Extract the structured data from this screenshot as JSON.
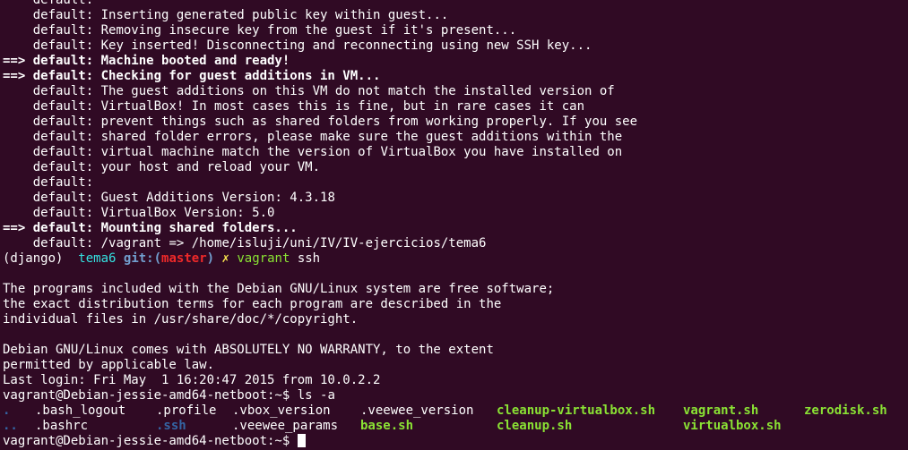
{
  "default_lines_top": [
    {
      "prefix": "    default:",
      "text": ""
    },
    {
      "prefix": "    default:",
      "text": " Inserting generated public key within guest..."
    },
    {
      "prefix": "    default:",
      "text": " Removing insecure key from the guest if it's present..."
    },
    {
      "prefix": "    default:",
      "text": " Key inserted! Disconnecting and reconnecting using new SSH key..."
    }
  ],
  "arrow_booted": "==> default: Machine booted and ready!",
  "arrow_checking": "==> default: Checking for guest additions in VM...",
  "default_lines_mid": [
    {
      "prefix": "    default:",
      "text": " The guest additions on this VM do not match the installed version of"
    },
    {
      "prefix": "    default:",
      "text": " VirtualBox! In most cases this is fine, but in rare cases it can"
    },
    {
      "prefix": "    default:",
      "text": " prevent things such as shared folders from working properly. If you see"
    },
    {
      "prefix": "    default:",
      "text": " shared folder errors, please make sure the guest additions within the"
    },
    {
      "prefix": "    default:",
      "text": " virtual machine match the version of VirtualBox you have installed on"
    },
    {
      "prefix": "    default:",
      "text": " your host and reload your VM."
    },
    {
      "prefix": "    default:",
      "text": ""
    },
    {
      "prefix": "    default:",
      "text": " Guest Additions Version: 4.3.18"
    },
    {
      "prefix": "    default:",
      "text": " VirtualBox Version: 5.0"
    }
  ],
  "arrow_mounting": "==> default: Mounting shared folders...",
  "mount_line": {
    "prefix": "    default:",
    "text": " /vagrant => /home/isluji/uni/IV/IV-ejercicios/tema6"
  },
  "prompt": {
    "venv": "(django)",
    "dir": "tema6",
    "git": "git:(",
    "branch": "master",
    "git_close": ")",
    "dirty": "✗",
    "command": "vagrant",
    "args": "ssh"
  },
  "motd": [
    "The programs included with the Debian GNU/Linux system are free software;",
    "the exact distribution terms for each program are described in the",
    "individual files in /usr/share/doc/*/copyright.",
    "",
    "Debian GNU/Linux comes with ABSOLUTELY NO WARRANTY, to the extent",
    "permitted by applicable law.",
    "Last login: Fri May  1 16:20:47 2015 from 10.0.2.2"
  ],
  "shell_prompt": "vagrant@Debian-jessie-amd64-netboot:~$",
  "ls_command": " ls -a",
  "ls_row1": [
    {
      "name": ".",
      "type": "dir"
    },
    {
      "name": ".bash_logout",
      "type": "file"
    },
    {
      "name": ".profile",
      "type": "file"
    },
    {
      "name": ".vbox_version",
      "type": "file"
    },
    {
      "name": ".veewee_version",
      "type": "file"
    },
    {
      "name": "cleanup-virtualbox.sh",
      "type": "exec"
    },
    {
      "name": "vagrant.sh",
      "type": "exec"
    },
    {
      "name": "zerodisk.sh",
      "type": "exec"
    }
  ],
  "ls_row2": [
    {
      "name": "..",
      "type": "dir"
    },
    {
      "name": ".bashrc",
      "type": "file"
    },
    {
      "name": ".ssh",
      "type": "dir"
    },
    {
      "name": ".veewee_params",
      "type": "file"
    },
    {
      "name": "base.sh",
      "type": "exec"
    },
    {
      "name": "cleanup.sh",
      "type": "exec"
    },
    {
      "name": "virtualbox.sh",
      "type": "exec"
    }
  ],
  "colors": {
    "background": "#300a24",
    "text": "#ffffff",
    "green": "#8ae234",
    "cyan": "#34e2e2",
    "red": "#ef2929",
    "yellow": "#fce94f",
    "blue": "#729fcf"
  }
}
